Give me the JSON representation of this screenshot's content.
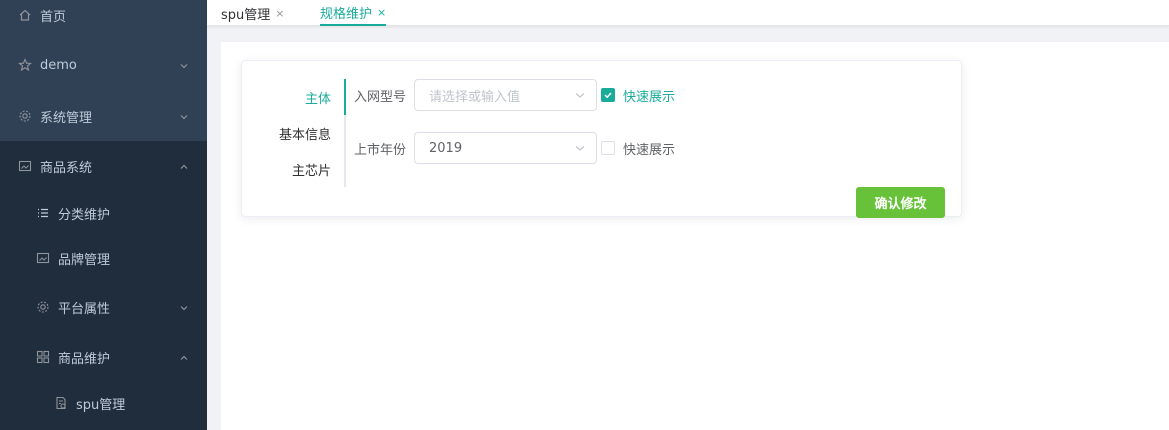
{
  "sidebar": {
    "items": [
      {
        "label": "首页",
        "icon": "home-icon"
      },
      {
        "label": "demo",
        "icon": "star-icon"
      },
      {
        "label": "系统管理",
        "icon": "gear-icon"
      },
      {
        "label": "商品系统",
        "icon": "picture-icon"
      },
      {
        "label": "分类维护",
        "icon": "list-icon"
      },
      {
        "label": "品牌管理",
        "icon": "picture-icon"
      },
      {
        "label": "平台属性",
        "icon": "gear-icon"
      },
      {
        "label": "商品维护",
        "icon": "grid-icon"
      },
      {
        "label": "spu管理",
        "icon": "document-icon"
      }
    ]
  },
  "tabs": [
    {
      "label": "spu管理",
      "close": "×"
    },
    {
      "label": "规格维护",
      "close": "×"
    }
  ],
  "vtabs": [
    "主体",
    "基本信息",
    "主芯片"
  ],
  "form": {
    "row1": {
      "label": "入网型号",
      "placeholder": "请选择或输入值",
      "check_label": "快速展示",
      "checked": true
    },
    "row2": {
      "label": "上市年份",
      "value": "2019",
      "check_label": "快速展示",
      "checked": false
    }
  },
  "confirm_label": "确认修改",
  "colors": {
    "accent": "#1aac9b",
    "success": "#67c23a",
    "sidebar_bg": "#304156",
    "submenu_bg": "#1f2d3d"
  }
}
